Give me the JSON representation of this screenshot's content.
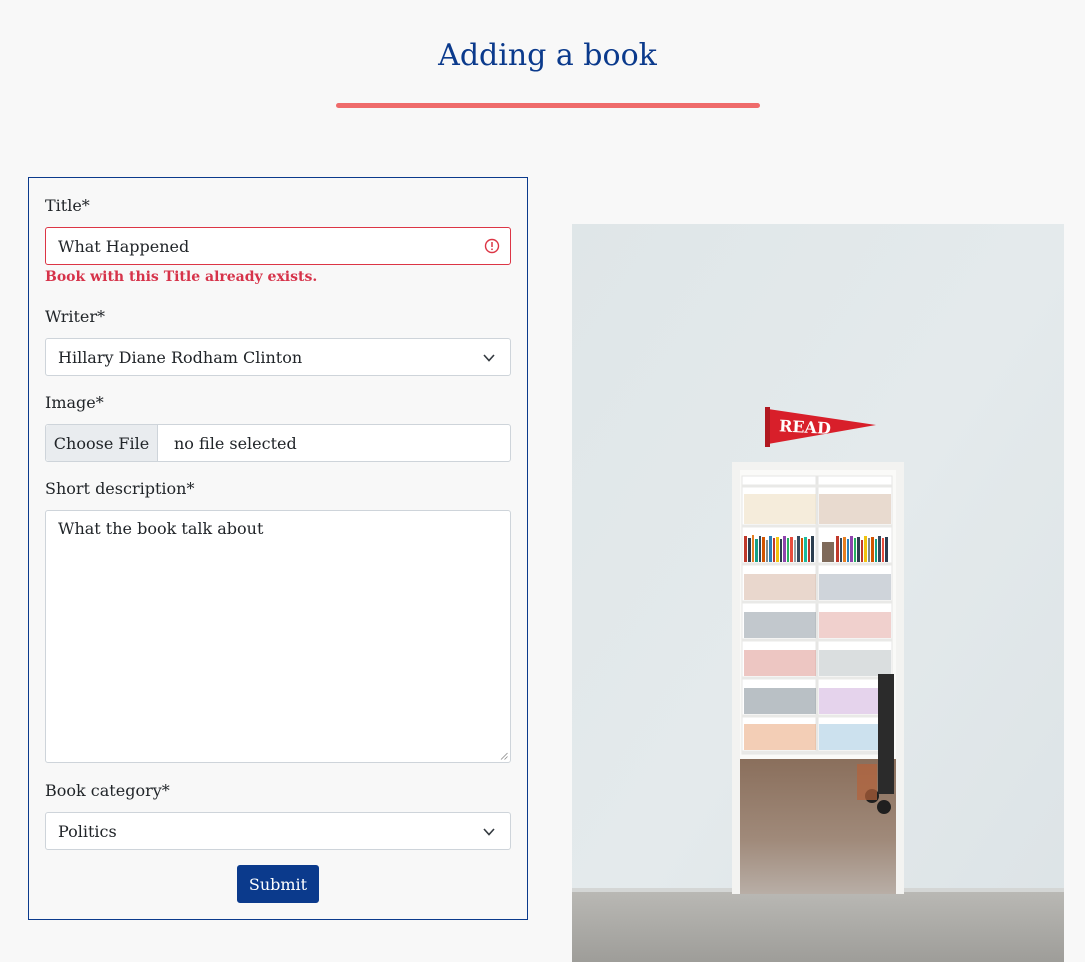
{
  "page": {
    "title": "Adding a book",
    "accent_color": "#ef6b6b",
    "brand_color": "#0b3a8c"
  },
  "form": {
    "title_label": "Title*",
    "title_value": "What Happened",
    "title_error": "Book with this Title already exists.",
    "writer_label": "Writer*",
    "writer_value": "Hillary Diane Rodham Clinton",
    "image_label": "Image*",
    "file_button_label": "Choose File",
    "file_status": "no file selected",
    "description_label": "Short description*",
    "description_value": "What the book talk about",
    "category_label": "Book category*",
    "category_value": "Politics",
    "submit_label": "Submit"
  },
  "photo": {
    "pennant_text": "READ"
  }
}
